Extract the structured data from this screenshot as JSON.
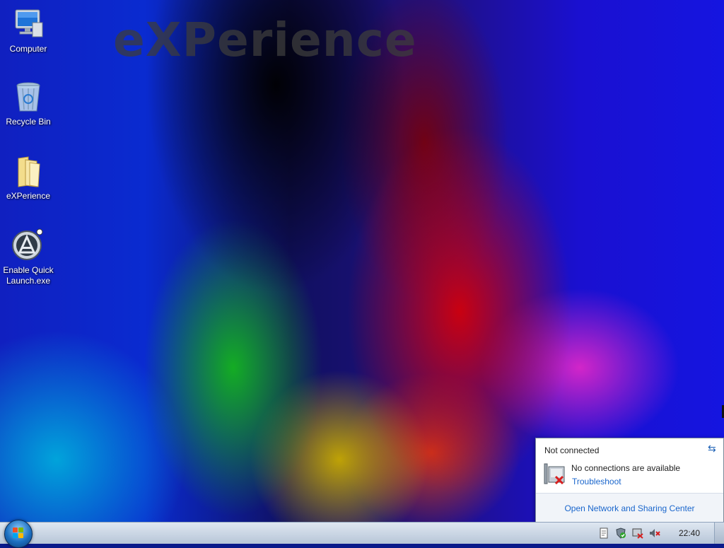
{
  "wallpaper": {
    "watermark": "eXPerience"
  },
  "desktop": {
    "icons": [
      {
        "label": "Computer",
        "icon": "computer-icon"
      },
      {
        "label": "Recycle Bin",
        "icon": "recycle-bin-icon"
      },
      {
        "label": "eXPerience",
        "icon": "folder-icon"
      },
      {
        "label_line1": "Enable Quick",
        "label_line2": "Launch.exe",
        "icon": "app-icon"
      }
    ]
  },
  "network_flyout": {
    "status": "Not connected",
    "message": "No connections are available",
    "troubleshoot_link": "Troubleshoot",
    "open_center_link": "Open Network and Sharing Center"
  },
  "taskbar": {
    "clock": "22:40",
    "tray_icons": [
      "notes-icon",
      "security-check-icon",
      "network-disconnected-icon",
      "volume-muted-icon"
    ]
  },
  "colors": {
    "link": "#1a66cc",
    "taskbar": "#c9d5e3",
    "error_red": "#d81e1e"
  }
}
